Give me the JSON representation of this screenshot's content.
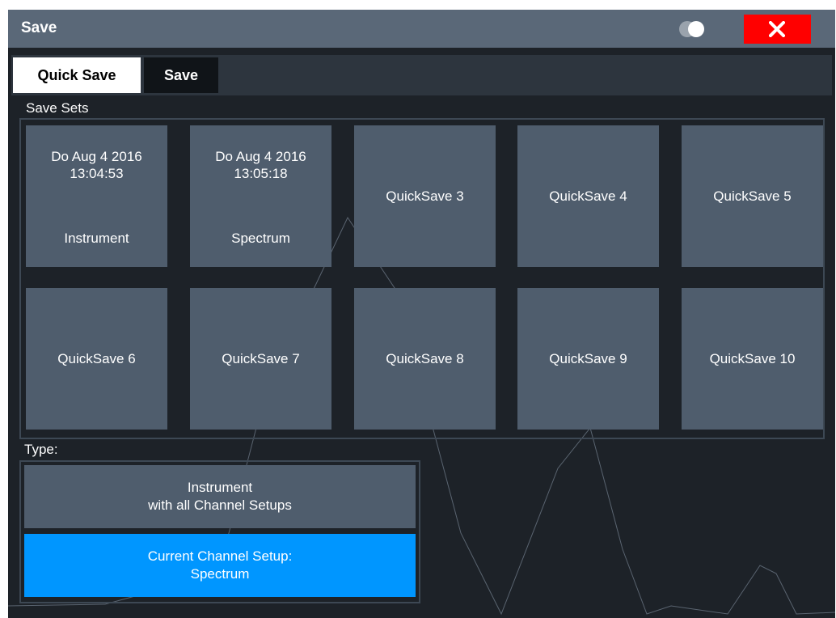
{
  "dialog": {
    "title": "Save",
    "icons": {
      "toggle": "toggle-icon",
      "close": "close-icon"
    },
    "close_color": "#ff0000"
  },
  "tabs": [
    {
      "label": "Quick Save",
      "active": true
    },
    {
      "label": "Save",
      "active": false
    }
  ],
  "save_sets": {
    "label": "Save Sets",
    "tiles": [
      {
        "date": "Do Aug 4 2016",
        "time": "13:04:53",
        "type": "Instrument"
      },
      {
        "date": "Do Aug 4 2016",
        "time": "13:05:18",
        "type": "Spectrum"
      },
      {
        "name": "QuickSave 3"
      },
      {
        "name": "QuickSave 4"
      },
      {
        "name": "QuickSave 5"
      },
      {
        "name": "QuickSave 6"
      },
      {
        "name": "QuickSave 7"
      },
      {
        "name": "QuickSave 8"
      },
      {
        "name": "QuickSave 9"
      },
      {
        "name": "QuickSave 10"
      }
    ]
  },
  "type": {
    "label": "Type:",
    "options": [
      {
        "line1": "Instrument",
        "line2": "with all Channel Setups",
        "selected": false
      },
      {
        "line1": "Current Channel Setup:",
        "line2": "Spectrum",
        "selected": true
      }
    ],
    "selected_color": "#0096ff"
  }
}
